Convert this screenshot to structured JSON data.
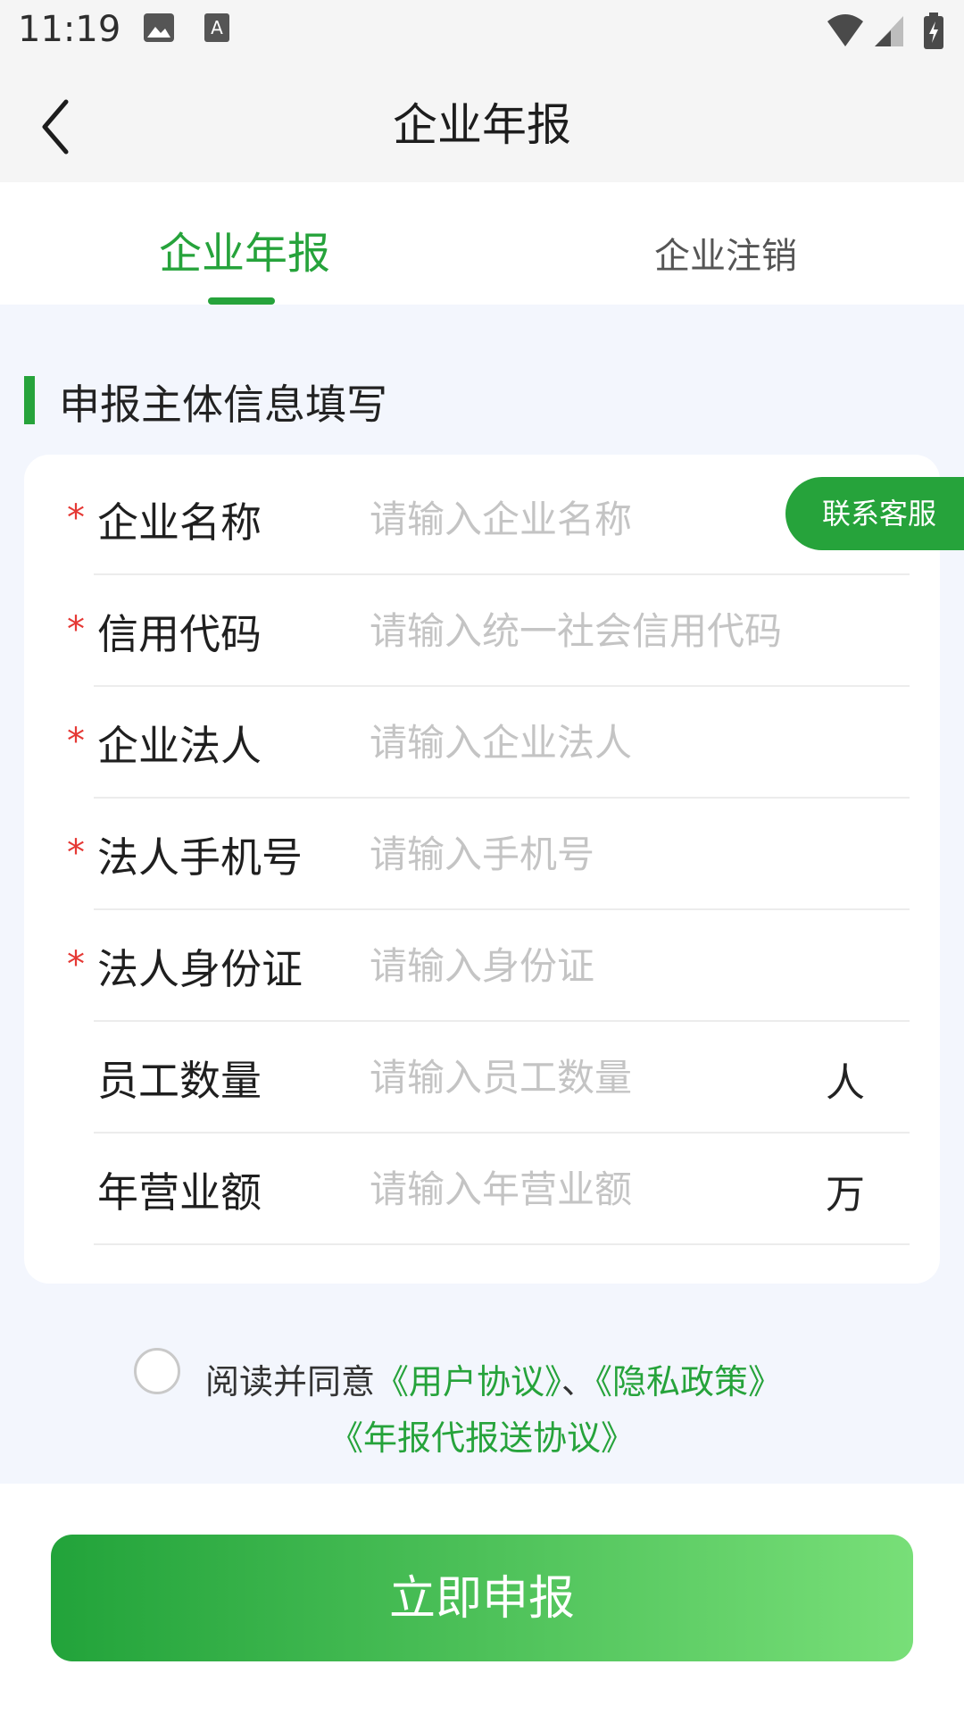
{
  "status_bar": {
    "time": "11:19"
  },
  "header": {
    "title": "企业年报"
  },
  "tabs": [
    {
      "label": "企业年报",
      "active": true
    },
    {
      "label": "企业注销",
      "active": false
    }
  ],
  "section": {
    "title": "申报主体信息填写"
  },
  "form": {
    "fields": [
      {
        "label": "企业名称",
        "required": true,
        "placeholder": "请输入企业名称",
        "unit": ""
      },
      {
        "label": "信用代码",
        "required": true,
        "placeholder": "请输入统一社会信用代码",
        "unit": ""
      },
      {
        "label": "企业法人",
        "required": true,
        "placeholder": "请输入企业法人",
        "unit": ""
      },
      {
        "label": "法人手机号",
        "required": true,
        "placeholder": "请输入手机号",
        "unit": ""
      },
      {
        "label": "法人身份证",
        "required": true,
        "placeholder": "请输入身份证",
        "unit": ""
      },
      {
        "label": "员工数量",
        "required": false,
        "placeholder": "请输入员工数量",
        "unit": "人"
      },
      {
        "label": "年营业额",
        "required": false,
        "placeholder": "请输入年营业额",
        "unit": "万"
      }
    ],
    "required_mark": "*"
  },
  "contact_button": "联系客服",
  "agreement": {
    "prefix": "阅读并同意",
    "user_agreement": "《用户协议》",
    "separator": "、",
    "privacy_policy": "《隐私政策》",
    "report_agreement": "《年报代报送协议》",
    "checked": false
  },
  "submit_label": "立即申报",
  "colors": {
    "accent": "#26a33b",
    "required": "#e53935",
    "background": "#f3f6fd"
  }
}
